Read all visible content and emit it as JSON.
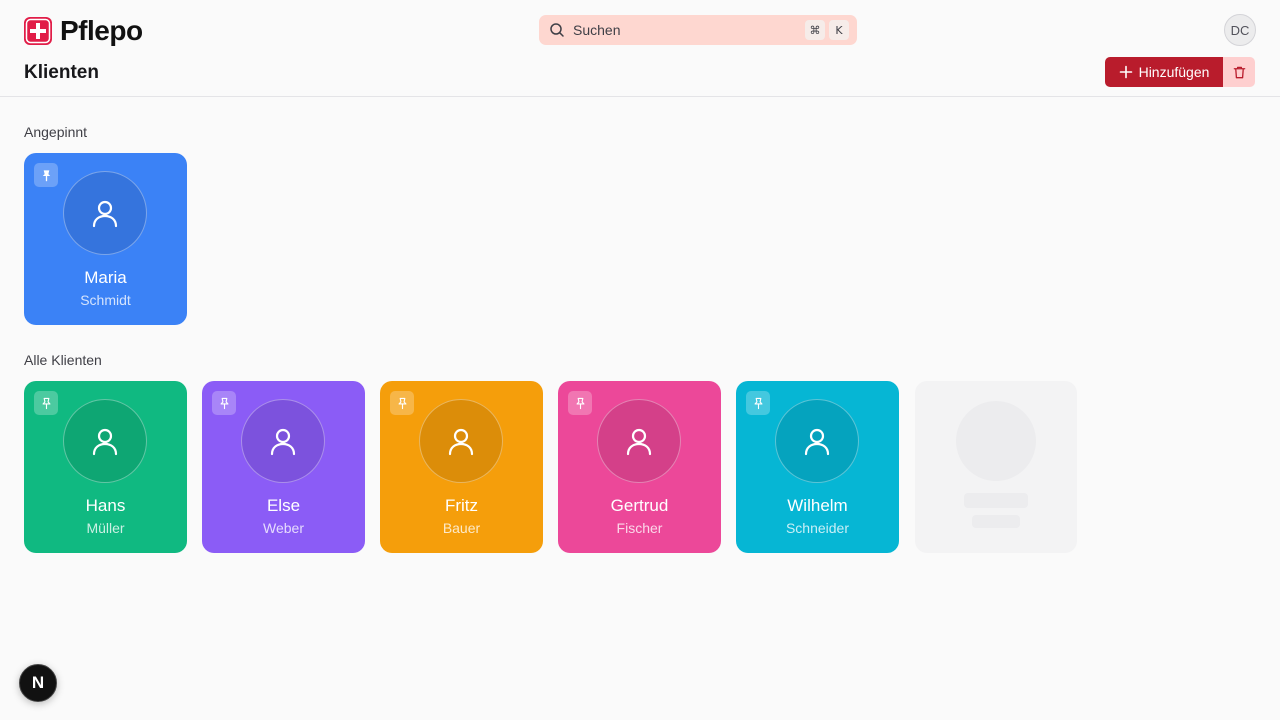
{
  "app": {
    "name": "Pflepo"
  },
  "search": {
    "placeholder": "Suchen",
    "shortcut_mod": "⌘",
    "shortcut_key": "K"
  },
  "user": {
    "initials": "DC"
  },
  "page": {
    "title": "Klienten"
  },
  "toolbar": {
    "add_label": "Hinzufügen"
  },
  "sections": {
    "pinned": "Angepinnt",
    "all": "Alle Klienten"
  },
  "pinned_clients": [
    {
      "first": "Maria",
      "last": "Schmidt",
      "color": "#3b82f6"
    }
  ],
  "clients": [
    {
      "first": "Hans",
      "last": "Müller",
      "color": "#10b981"
    },
    {
      "first": "Else",
      "last": "Weber",
      "color": "#8b5cf6"
    },
    {
      "first": "Fritz",
      "last": "Bauer",
      "color": "#f59e0b"
    },
    {
      "first": "Gertrud",
      "last": "Fischer",
      "color": "#ec4899"
    },
    {
      "first": "Wilhelm",
      "last": "Schneider",
      "color": "#06b6d4"
    }
  ],
  "dev_badge": {
    "letter": "N"
  },
  "colors": {
    "brand": "#e11d48",
    "add_button": "#b91c2c",
    "delete_button_bg": "#fecfcf",
    "search_bg": "#fed7d0"
  }
}
